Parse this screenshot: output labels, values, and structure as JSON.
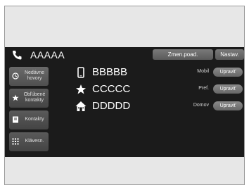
{
  "header": {
    "title": "AAAAA",
    "phone_icon": "phone-handset-icon",
    "buttons": {
      "zmen": "Zmen.poad.",
      "nastav": "Nastav."
    }
  },
  "sidebar": {
    "items": [
      {
        "label": "Nedávne hovory",
        "icon": "recent-calls-icon"
      },
      {
        "label": "Obľúbené kontakty",
        "icon": "star-icon"
      },
      {
        "label": "Kontakty",
        "icon": "contacts-book-icon"
      },
      {
        "label": "Klávesn.",
        "icon": "keypad-icon"
      }
    ]
  },
  "contacts": [
    {
      "name": "BBBBB",
      "type": "Mobil",
      "icon": "mobile-phone-icon",
      "edit": "Upraviť"
    },
    {
      "name": "CCCCC",
      "type": "Pref.",
      "icon": "star-icon",
      "edit": "Upraviť"
    },
    {
      "name": "DDDDD",
      "type": "Domov",
      "icon": "home-icon",
      "edit": "Upraviť"
    }
  ],
  "colors": {
    "screen_bg": "#1b1b1b",
    "text": "#ffffff",
    "button": "#707070"
  }
}
